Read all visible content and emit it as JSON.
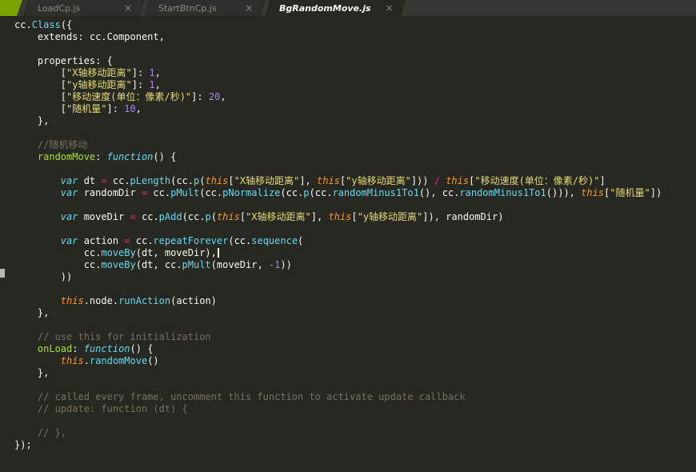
{
  "colors": {
    "background": "#272822",
    "tabbar": "#373734",
    "tab_inactive": "#2f2f2b",
    "tab_active": "#272822",
    "accent": "#79a303",
    "text": "#f8f8f2",
    "keyword": "#66d9ef",
    "func": "#66d9ef",
    "name": "#a6e22e",
    "string": "#e6db74",
    "number": "#ae81ff",
    "operator": "#f92672",
    "comment": "#75715e",
    "this_kw": "#fd971f",
    "tab_text": "#8a8a84",
    "tab_text_active": "#f8f8f2"
  },
  "close_label": "×",
  "tabs": [
    {
      "label": "LoadCp.js",
      "active": false
    },
    {
      "label": "StartBtnCp.js",
      "active": false
    },
    {
      "label": "BgRandomMove.js",
      "active": true
    }
  ],
  "code": {
    "lines": [
      [
        [
          "p",
          "cc."
        ],
        [
          "f",
          "Class"
        ],
        [
          "p",
          "({"
        ]
      ],
      [
        [
          "p",
          "    extends: cc.Component,"
        ]
      ],
      [],
      [
        [
          "p",
          "    properties: {"
        ]
      ],
      [
        [
          "p",
          "        ["
        ],
        [
          "s",
          "\"X轴移动距离\""
        ],
        [
          "p",
          "]: "
        ],
        [
          "n",
          "1"
        ],
        [
          "p",
          ","
        ]
      ],
      [
        [
          "p",
          "        ["
        ],
        [
          "s",
          "\"y轴移动距离\""
        ],
        [
          "p",
          "]: "
        ],
        [
          "n",
          "1"
        ],
        [
          "p",
          ","
        ]
      ],
      [
        [
          "p",
          "        ["
        ],
        [
          "s",
          "\"移动速度(单位：像素/秒)\""
        ],
        [
          "p",
          "]: "
        ],
        [
          "n",
          "20"
        ],
        [
          "p",
          ","
        ]
      ],
      [
        [
          "p",
          "        ["
        ],
        [
          "s",
          "\"随机量\""
        ],
        [
          "p",
          "]: "
        ],
        [
          "n",
          "10"
        ],
        [
          "p",
          ","
        ]
      ],
      [
        [
          "p",
          "    },"
        ]
      ],
      [],
      [
        [
          "c",
          "    //随机移动"
        ]
      ],
      [
        [
          "p",
          "    "
        ],
        [
          "g",
          "randomMove"
        ],
        [
          "p",
          ": "
        ],
        [
          "k",
          "function"
        ],
        [
          "p",
          "() {"
        ]
      ],
      [],
      [
        [
          "p",
          "        "
        ],
        [
          "k",
          "var"
        ],
        [
          "p",
          " dt "
        ],
        [
          "o",
          "="
        ],
        [
          "p",
          " cc."
        ],
        [
          "f",
          "pLength"
        ],
        [
          "p",
          "(cc."
        ],
        [
          "f",
          "p"
        ],
        [
          "p",
          "("
        ],
        [
          "t",
          "this"
        ],
        [
          "p",
          "["
        ],
        [
          "s",
          "\"X轴移动距离\""
        ],
        [
          "p",
          "], "
        ],
        [
          "t",
          "this"
        ],
        [
          "p",
          "["
        ],
        [
          "s",
          "\"y轴移动距离\""
        ],
        [
          "p",
          "])) "
        ],
        [
          "o",
          "/"
        ],
        [
          "p",
          " "
        ],
        [
          "t",
          "this"
        ],
        [
          "p",
          "["
        ],
        [
          "s",
          "\"移动速度(单位：像素/秒)\""
        ],
        [
          "p",
          "]"
        ]
      ],
      [
        [
          "p",
          "        "
        ],
        [
          "k",
          "var"
        ],
        [
          "p",
          " randomDir "
        ],
        [
          "o",
          "="
        ],
        [
          "p",
          " cc."
        ],
        [
          "f",
          "pMult"
        ],
        [
          "p",
          "(cc."
        ],
        [
          "f",
          "pNormalize"
        ],
        [
          "p",
          "(cc."
        ],
        [
          "f",
          "p"
        ],
        [
          "p",
          "(cc."
        ],
        [
          "f",
          "randomMinus1To1"
        ],
        [
          "p",
          "(), cc."
        ],
        [
          "f",
          "randomMinus1To1"
        ],
        [
          "p",
          "())), "
        ],
        [
          "t",
          "this"
        ],
        [
          "p",
          "["
        ],
        [
          "s",
          "\"随机量\""
        ],
        [
          "p",
          "])"
        ]
      ],
      [],
      [
        [
          "p",
          "        "
        ],
        [
          "k",
          "var"
        ],
        [
          "p",
          " moveDir "
        ],
        [
          "o",
          "="
        ],
        [
          "p",
          " cc."
        ],
        [
          "f",
          "pAdd"
        ],
        [
          "p",
          "(cc."
        ],
        [
          "f",
          "p"
        ],
        [
          "p",
          "("
        ],
        [
          "t",
          "this"
        ],
        [
          "p",
          "["
        ],
        [
          "s",
          "\"X轴移动距离\""
        ],
        [
          "p",
          "], "
        ],
        [
          "t",
          "this"
        ],
        [
          "p",
          "["
        ],
        [
          "s",
          "\"y轴移动距离\""
        ],
        [
          "p",
          "]), randomDir)"
        ]
      ],
      [],
      [
        [
          "p",
          "        "
        ],
        [
          "k",
          "var"
        ],
        [
          "p",
          " action "
        ],
        [
          "o",
          "="
        ],
        [
          "p",
          " cc."
        ],
        [
          "f",
          "repeatForever"
        ],
        [
          "p",
          "(cc."
        ],
        [
          "f",
          "sequence"
        ],
        [
          "p",
          "("
        ]
      ],
      [
        [
          "p",
          "            cc."
        ],
        [
          "f",
          "moveBy"
        ],
        [
          "p",
          "(dt, moveDir),"
        ],
        [
          "caret",
          ""
        ]
      ],
      [
        [
          "p",
          "            cc."
        ],
        [
          "f",
          "moveBy"
        ],
        [
          "p",
          "(dt, cc."
        ],
        [
          "f",
          "pMult"
        ],
        [
          "p",
          "(moveDir, "
        ],
        [
          "n",
          "-1"
        ],
        [
          "p",
          "))"
        ]
      ],
      [
        [
          "p",
          "        ))"
        ]
      ],
      [],
      [
        [
          "p",
          "        "
        ],
        [
          "t",
          "this"
        ],
        [
          "p",
          ".node."
        ],
        [
          "f",
          "runAction"
        ],
        [
          "p",
          "(action)"
        ]
      ],
      [
        [
          "p",
          "    },"
        ]
      ],
      [],
      [
        [
          "c",
          "    // use this for initialization"
        ]
      ],
      [
        [
          "p",
          "    "
        ],
        [
          "g",
          "onLoad"
        ],
        [
          "p",
          ": "
        ],
        [
          "k",
          "function"
        ],
        [
          "p",
          "() {"
        ]
      ],
      [
        [
          "p",
          "        "
        ],
        [
          "t",
          "this"
        ],
        [
          "p",
          "."
        ],
        [
          "f",
          "randomMove"
        ],
        [
          "p",
          "()"
        ]
      ],
      [
        [
          "p",
          "    },"
        ]
      ],
      [],
      [
        [
          "c",
          "    // called every frame, uncomment this function to activate update callback"
        ]
      ],
      [
        [
          "c",
          "    // update: function (dt) {"
        ]
      ],
      [],
      [
        [
          "c",
          "    // },"
        ]
      ],
      [
        [
          "p",
          "});"
        ]
      ]
    ]
  }
}
